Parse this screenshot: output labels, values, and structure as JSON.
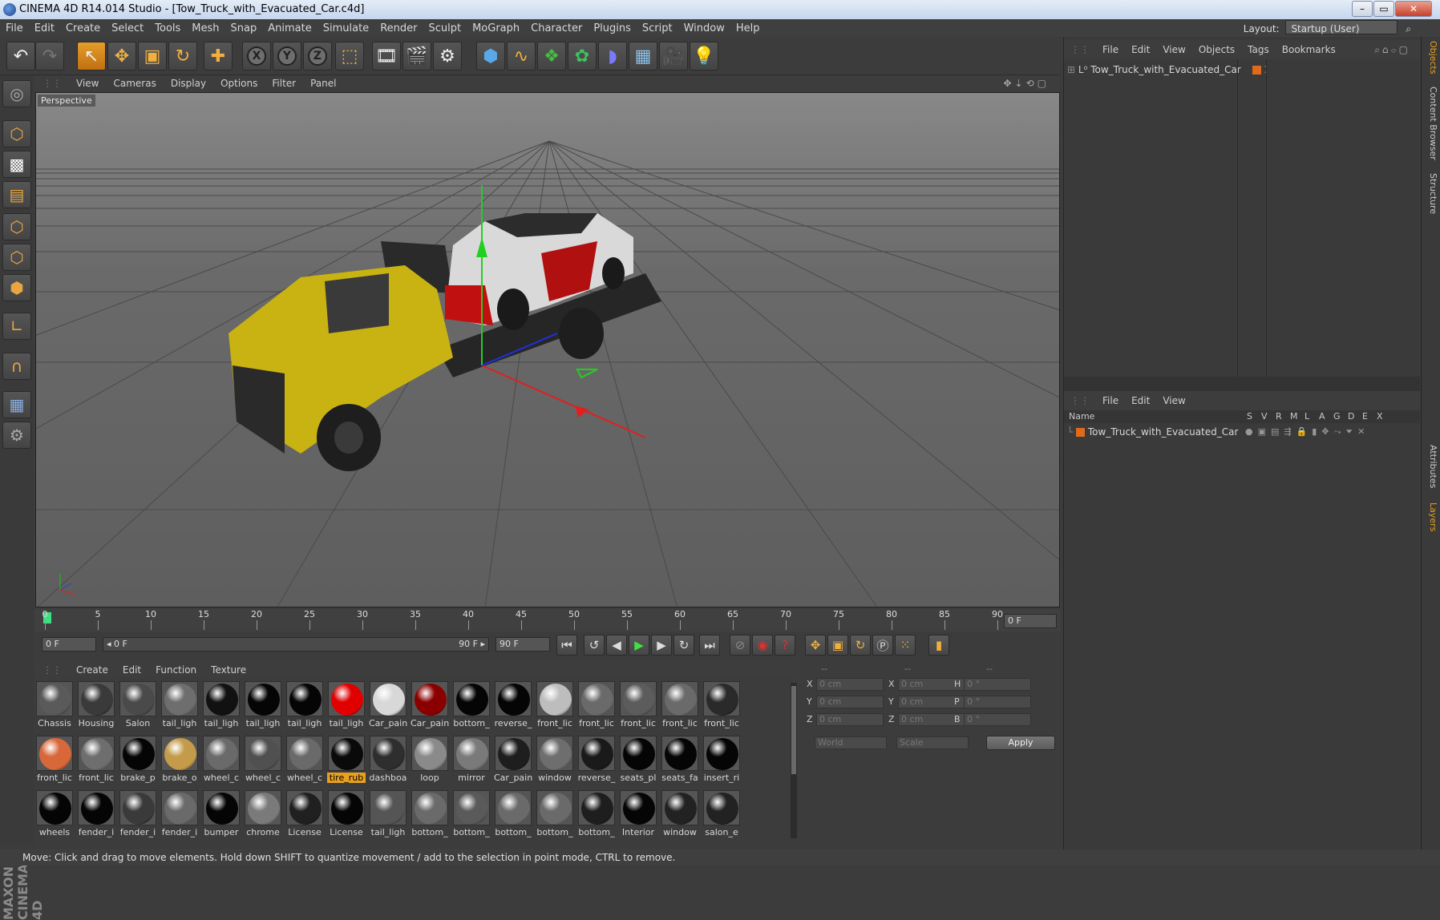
{
  "window": {
    "title": "CINEMA 4D R14.014 Studio - [Tow_Truck_with_Evacuated_Car.c4d]",
    "minimize": "–",
    "maximize": "▭",
    "close": "✕"
  },
  "menu": [
    "File",
    "Edit",
    "Create",
    "Select",
    "Tools",
    "Mesh",
    "Snap",
    "Animate",
    "Simulate",
    "Render",
    "Sculpt",
    "MoGraph",
    "Character",
    "Plugins",
    "Script",
    "Window",
    "Help"
  ],
  "layout": {
    "label": "Layout:",
    "value": "Startup (User)"
  },
  "viewport": {
    "menu": [
      "View",
      "Cameras",
      "Display",
      "Options",
      "Filter",
      "Panel"
    ],
    "label": "Perspective"
  },
  "timeline": {
    "ticks": [
      "0",
      "5",
      "10",
      "15",
      "20",
      "25",
      "30",
      "35",
      "40",
      "45",
      "50",
      "55",
      "60",
      "65",
      "70",
      "75",
      "80",
      "85",
      "90"
    ],
    "current_frame": "0 F",
    "start": "0 F",
    "range_start": "◂ 0 F",
    "range_end": "90 F ▸",
    "end": "90 F"
  },
  "materials": {
    "menu": [
      "Create",
      "Edit",
      "Function",
      "Texture"
    ],
    "rows": [
      [
        {
          "name": "Chassis",
          "color": "#5a5a5a"
        },
        {
          "name": "Housing",
          "color": "#3a3a3a"
        },
        {
          "name": "Salon",
          "color": "#4a4a4a"
        },
        {
          "name": "tail_ligh",
          "color": "#6e6e6e"
        },
        {
          "name": "tail_ligh",
          "color": "#111111"
        },
        {
          "name": "tail_ligh",
          "color": "#050505"
        },
        {
          "name": "tail_ligh",
          "color": "#050505"
        },
        {
          "name": "tail_ligh",
          "color": "#e00000"
        },
        {
          "name": "Car_pain",
          "color": "#d8d8d8"
        },
        {
          "name": "Car_pain",
          "color": "#8a0000"
        },
        {
          "name": "bottom_",
          "color": "#050505"
        },
        {
          "name": "reverse_",
          "color": "#050505"
        },
        {
          "name": "front_lic",
          "color": "#bdbdbd"
        },
        {
          "name": "front_lic",
          "color": "#6a6a6a"
        },
        {
          "name": "front_lic",
          "color": "#5c5c5c"
        },
        {
          "name": "front_lic",
          "color": "#6a6a6a"
        },
        {
          "name": "front_lic",
          "color": "#2a2a2a"
        }
      ],
      [
        {
          "name": "front_lic",
          "color": "#d8683a"
        },
        {
          "name": "front_lic",
          "color": "#6e6e6e"
        },
        {
          "name": "brake_p",
          "color": "#050505"
        },
        {
          "name": "brake_o",
          "color": "#c49b4a"
        },
        {
          "name": "wheel_c",
          "color": "#6a6a6a"
        },
        {
          "name": "wheel_c",
          "color": "#505050"
        },
        {
          "name": "wheel_c",
          "color": "#6a6a6a"
        },
        {
          "name": "tire_rub",
          "color": "#0a0a0a"
        },
        {
          "name": "dashboa",
          "color": "#2e2e2e"
        },
        {
          "name": "loop",
          "color": "#8a8a8a"
        },
        {
          "name": "mirror",
          "color": "#7a7a7a"
        },
        {
          "name": "Car_pain",
          "color": "#1e1e1e"
        },
        {
          "name": "window",
          "color": "#6e6e6e"
        },
        {
          "name": "reverse_",
          "color": "#1a1a1a"
        },
        {
          "name": "seats_pl",
          "color": "#050505"
        },
        {
          "name": "seats_fa",
          "color": "#050505"
        },
        {
          "name": "insert_ri",
          "color": "#050505"
        }
      ],
      [
        {
          "name": "wheels",
          "color": "#050505"
        },
        {
          "name": "fender_i",
          "color": "#050505"
        },
        {
          "name": "fender_i",
          "color": "#3a3a3a"
        },
        {
          "name": "fender_i",
          "color": "#6a6a6a"
        },
        {
          "name": "bumper",
          "color": "#050505"
        },
        {
          "name": "chrome",
          "color": "#7a7a7a"
        },
        {
          "name": "License",
          "color": "#202020"
        },
        {
          "name": "License",
          "color": "#050505"
        },
        {
          "name": "tail_ligh",
          "color": "#555555"
        },
        {
          "name": "bottom_",
          "color": "#6a6a6a"
        },
        {
          "name": "bottom_",
          "color": "#5a5a5a"
        },
        {
          "name": "bottom_",
          "color": "#6a6a6a"
        },
        {
          "name": "bottom_",
          "color": "#6a6a6a"
        },
        {
          "name": "bottom_",
          "color": "#1e1e1e"
        },
        {
          "name": "Interior",
          "color": "#050505"
        },
        {
          "name": "window",
          "color": "#222222"
        },
        {
          "name": "salon_e",
          "color": "#222222"
        }
      ]
    ],
    "highlighted": "tire_rub"
  },
  "coords": {
    "header_a": "--",
    "header_b": "--",
    "header_c": "--",
    "rows": [
      {
        "a": "X",
        "av": "0 cm",
        "b": "X",
        "bv": "0 cm",
        "c": "H",
        "cv": "0 °"
      },
      {
        "a": "Y",
        "av": "0 cm",
        "b": "Y",
        "bv": "0 cm",
        "c": "P",
        "cv": "0 °"
      },
      {
        "a": "Z",
        "av": "0 cm",
        "b": "Z",
        "bv": "0 cm",
        "c": "B",
        "cv": "0 °"
      }
    ],
    "world": "World",
    "scale": "Scale",
    "apply": "Apply"
  },
  "objects": {
    "menu": [
      "File",
      "Edit",
      "View",
      "Objects",
      "Tags",
      "Bookmarks"
    ],
    "item": "Tow_Truck_with_Evacuated_Car"
  },
  "layers": {
    "menu": [
      "File",
      "Edit",
      "View"
    ],
    "columns": [
      "Name",
      "S",
      "V",
      "R",
      "M",
      "L",
      "A",
      "G",
      "D",
      "E",
      "X"
    ],
    "item": "Tow_Truck_with_Evacuated_Car"
  },
  "side_tabs": [
    "Objects",
    "Content Browser",
    "Structure",
    "Attributes",
    "Layers"
  ],
  "brand": "MAXON CINEMA 4D",
  "status": "Move: Click and drag to move elements. Hold down SHIFT to quantize movement / add to the selection in point mode, CTRL to remove.",
  "colors": {
    "accent": "#e8a020",
    "tag": "#e06a1c"
  }
}
